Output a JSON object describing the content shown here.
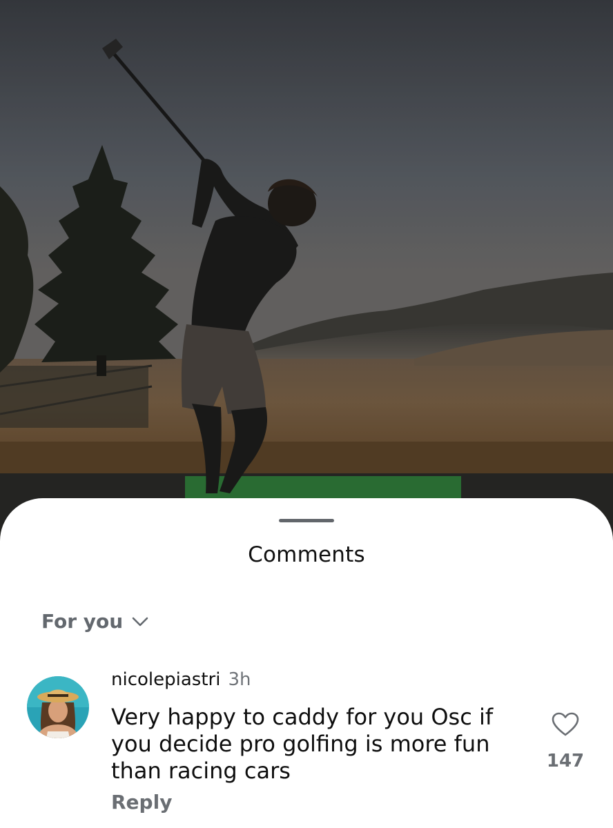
{
  "photo": {
    "subject": "golfer silhouette mid-swing on driving range at dusk"
  },
  "sheet": {
    "title": "Comments",
    "filter": {
      "label": "For you",
      "icon": "chevron-down-icon"
    }
  },
  "comments": [
    {
      "username": "nicolepiastri",
      "time": "3h",
      "text": "Very happy to caddy for you Osc if you decide pro golfing is more fun than racing cars",
      "reply_label": "Reply",
      "like_icon": "heart-outline-icon",
      "like_count": "147"
    }
  ],
  "colors": {
    "sheet_bg": "#ffffff",
    "text_primary": "#101010",
    "text_secondary": "#6a6e73",
    "handle": "#62666b"
  }
}
